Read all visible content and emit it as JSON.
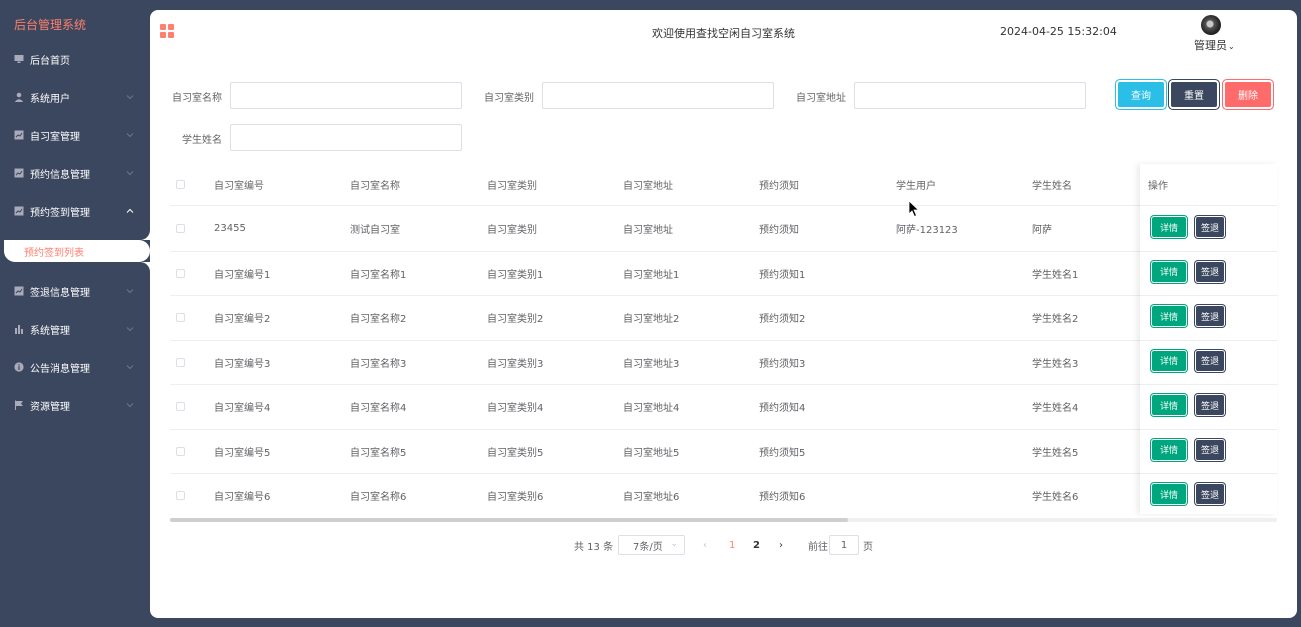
{
  "sidebar": {
    "brand": "后台管理系统",
    "items": [
      {
        "label": "后台首页",
        "icon": "monitor-icon"
      },
      {
        "label": "系统用户",
        "icon": "user-icon"
      },
      {
        "label": "自习室管理",
        "icon": "chart-icon"
      },
      {
        "label": "预约信息管理",
        "icon": "chart-icon"
      },
      {
        "label": "预约签到管理",
        "icon": "chart-icon"
      },
      {
        "label": "签退信息管理",
        "icon": "chart-icon"
      },
      {
        "label": "系统管理",
        "icon": "bar-chart-icon"
      },
      {
        "label": "公告消息管理",
        "icon": "info-icon"
      },
      {
        "label": "资源管理",
        "icon": "flag-icon"
      }
    ],
    "active_submenu": "预约签到列表"
  },
  "header": {
    "title": "欢迎使用查找空闲自习室系统",
    "datetime": "2024-04-25 15:32:04",
    "user": "管理员"
  },
  "search": {
    "name_label": "自习室名称",
    "type_label": "自习室类别",
    "address_label": "自习室地址",
    "student_label": "学生姓名",
    "query": "查询",
    "reset": "重置",
    "delete": "删除"
  },
  "table": {
    "columns": [
      "自习室编号",
      "自习室名称",
      "自习室类别",
      "自习室地址",
      "预约须知",
      "学生用户",
      "学生姓名",
      "操作"
    ],
    "rows": [
      [
        "23455",
        "测试自习室",
        "自习室类别",
        "自习室地址",
        "预约须知",
        "阿萨-123123",
        "阿萨"
      ],
      [
        "自习室编号1",
        "自习室名称1",
        "自习室类别1",
        "自习室地址1",
        "预约须知1",
        "",
        "学生姓名1"
      ],
      [
        "自习室编号2",
        "自习室名称2",
        "自习室类别2",
        "自习室地址2",
        "预约须知2",
        "",
        "学生姓名2"
      ],
      [
        "自习室编号3",
        "自习室名称3",
        "自习室类别3",
        "自习室地址3",
        "预约须知3",
        "",
        "学生姓名3"
      ],
      [
        "自习室编号4",
        "自习室名称4",
        "自习室类别4",
        "自习室地址4",
        "预约须知4",
        "",
        "学生姓名4"
      ],
      [
        "自习室编号5",
        "自习室名称5",
        "自习室类别5",
        "自习室地址5",
        "预约须知5",
        "",
        "学生姓名5"
      ],
      [
        "自习室编号6",
        "自习室名称6",
        "自习室类别6",
        "自习室地址6",
        "预约须知6",
        "",
        "学生姓名6"
      ]
    ],
    "detail_label": "详情",
    "checkout_label": "签退"
  },
  "pagination": {
    "total": "共 13 条",
    "page_size": "7条/页",
    "pages": [
      "1",
      "2"
    ],
    "current_page": "1",
    "goto_label": "前往",
    "goto_value": "1",
    "page_suffix": "页"
  },
  "colors": {
    "sidebar_bg": "#3b475e",
    "accent": "#ff7f6e",
    "query_btn": "#2bbfe8",
    "delete_btn": "#ff6b6b",
    "detail_btn": "#00a67d"
  }
}
